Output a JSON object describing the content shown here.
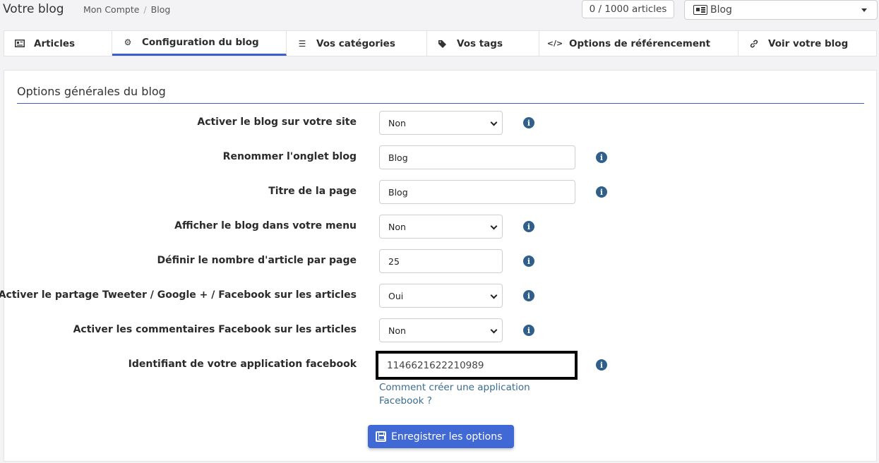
{
  "header": {
    "title": "Votre blog",
    "breadcrumb": [
      "Mon Compte",
      "Blog"
    ],
    "breadcrumb_sep": "/",
    "counter": "0 / 1000 articles",
    "blog_select": "Blog"
  },
  "tabs": [
    {
      "label": "Articles",
      "icon": "newspaper-icon"
    },
    {
      "label": "Configuration du blog",
      "icon": "gear-icon",
      "active": true
    },
    {
      "label": "Vos catégories",
      "icon": "list-icon"
    },
    {
      "label": "Vos tags",
      "icon": "tags-icon"
    },
    {
      "label": "Options de référencement",
      "icon": "code-icon"
    },
    {
      "label": "Voir votre blog",
      "icon": "link-icon"
    }
  ],
  "panel": {
    "legend": "Options générales du blog",
    "fields": [
      {
        "label": "Activer le blog sur votre site",
        "value": "Non",
        "type": "select"
      },
      {
        "label": "Renommer l'onglet blog",
        "value": "Blog",
        "type": "text"
      },
      {
        "label": "Titre de la page",
        "value": "Blog",
        "type": "text"
      },
      {
        "label": "Afficher le blog dans votre menu",
        "value": "Non",
        "type": "select"
      },
      {
        "label": "Définir le nombre d'article par page",
        "value": "25",
        "type": "text"
      },
      {
        "label": "Activer le partage Tweeter / Google + / Facebook sur les articles",
        "value": "Oui",
        "type": "select"
      },
      {
        "label": "Activer les commentaires Facebook sur les articles",
        "value": "Non",
        "type": "select"
      },
      {
        "label": "Identifiant de votre application facebook",
        "value": "1146621622210989",
        "type": "text"
      }
    ],
    "info_glyph": "i",
    "help_link": "Comment créer une application Facebook ?",
    "save_label": "Enregistrer les options"
  },
  "colors": {
    "accent": "#3a5fc8",
    "button": "#4169d6",
    "info": "#2f5f8a",
    "link": "#3a6c8f"
  }
}
